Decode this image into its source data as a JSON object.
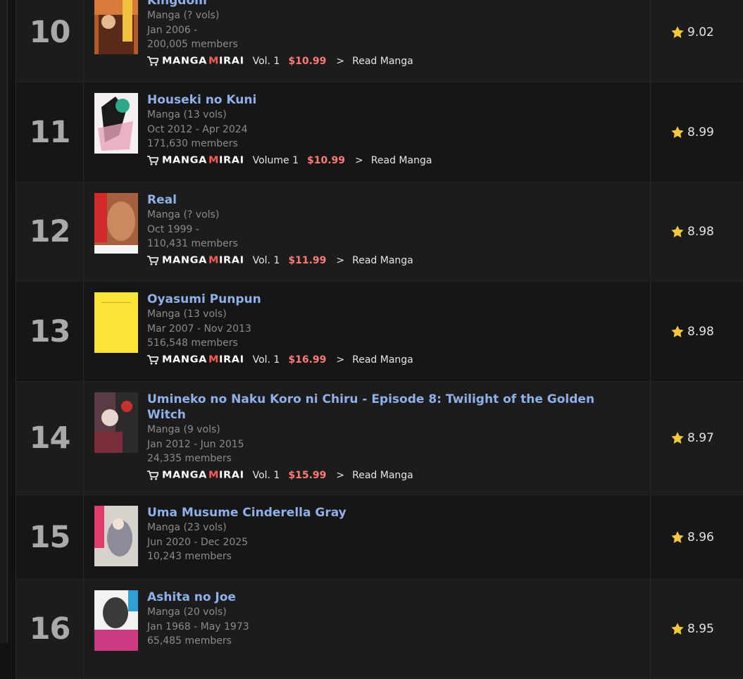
{
  "buy_logo": {
    "part1": "MANGA",
    "part2": "M",
    "part3": "IRAI"
  },
  "entries": [
    {
      "rank": "10",
      "title": "Kingdom",
      "type": "Manga (? vols)",
      "dates": "Jan 2006 -",
      "members": "200,005 members",
      "vol": "Vol. 1",
      "price": "$10.99",
      "arrow": ">",
      "read": "Read Manga",
      "score": "9.02",
      "cover_color": "#b35a2a"
    },
    {
      "rank": "11",
      "title": "Houseki no Kuni",
      "type": "Manga (13 vols)",
      "dates": "Oct 2012 - Apr 2024",
      "members": "171,630 members",
      "vol": "Volume 1",
      "price": "$10.99",
      "arrow": ">",
      "read": "Read Manga",
      "score": "8.99",
      "cover_color": "#e9e4e6"
    },
    {
      "rank": "12",
      "title": "Real",
      "type": "Manga (? vols)",
      "dates": "Oct 1999 -",
      "members": "110,431 members",
      "vol": "Vol. 1",
      "price": "$11.99",
      "arrow": ">",
      "read": "Read Manga",
      "score": "8.98",
      "cover_color": "#a4603f"
    },
    {
      "rank": "13",
      "title": "Oyasumi Punpun",
      "type": "Manga (13 vols)",
      "dates": "Mar 2007 - Nov 2013",
      "members": "516,548 members",
      "vol": "Vol. 1",
      "price": "$16.99",
      "arrow": ">",
      "read": "Read Manga",
      "score": "8.98",
      "cover_color": "#fde23a"
    },
    {
      "rank": "14",
      "title": "Umineko no Naku Koro ni Chiru - Episode 8: Twilight of the Golden Witch",
      "type": "Manga (9 vols)",
      "dates": "Jan 2012 - Jun 2015",
      "members": "24,335 members",
      "vol": "Vol. 1",
      "price": "$15.99",
      "arrow": ">",
      "read": "Read Manga",
      "score": "8.97",
      "cover_color": "#5b3c44"
    },
    {
      "rank": "15",
      "title": "Uma Musume Cinderella Gray",
      "type": "Manga (23 vols)",
      "dates": "Jun 2020 - Dec 2025",
      "members": "10,243 members",
      "score": "8.96",
      "cover_color": "#d8d2cc"
    },
    {
      "rank": "16",
      "title": "Ashita no Joe",
      "type": "Manga (20 vols)",
      "dates": "Jan 1968 - May 1973",
      "members": "65,485 members",
      "score": "8.95",
      "cover_color": "#c93a80"
    }
  ],
  "colors": {
    "title_link": "#8fb0e9",
    "price": "#ff7b74",
    "star": "#f4c73c"
  }
}
